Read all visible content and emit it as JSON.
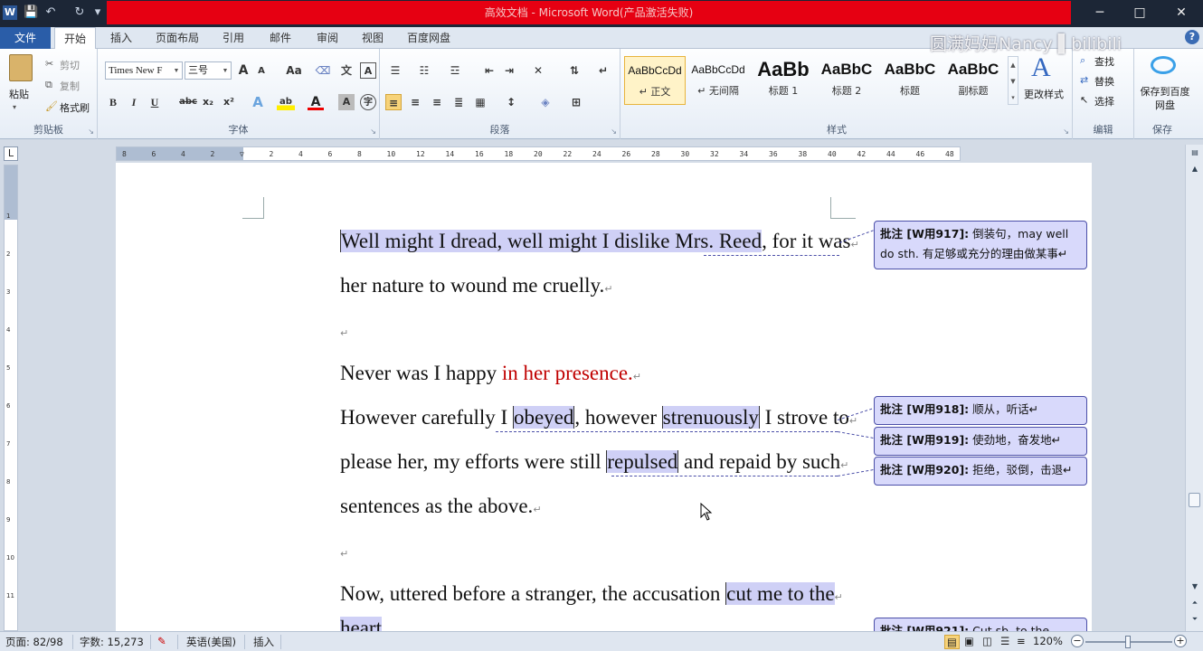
{
  "window": {
    "title": "高效文档 - Microsoft Word(产品激活失败)",
    "app_icon": "W",
    "watermark": "圆满妈妈Nancy ▌bilibili",
    "controls": {
      "minimize": "─",
      "maximize": "□",
      "close": "✕"
    }
  },
  "qat": {
    "save_icon": "💾",
    "undo_icon": "↶",
    "redo_icon": "↻",
    "more_icon": "▾"
  },
  "tabs": {
    "file": "文件",
    "items": [
      "开始",
      "插入",
      "页面布局",
      "引用",
      "邮件",
      "审阅",
      "视图",
      "百度网盘"
    ],
    "active": "开始",
    "help": "?"
  },
  "ribbon": {
    "clipboard": {
      "label": "剪贴板",
      "paste": "粘贴",
      "cut": "剪切",
      "copy": "复制",
      "format_painter": "格式刷"
    },
    "font": {
      "label": "字体",
      "font_name": "Times New F",
      "font_size": "三号",
      "grow": "A",
      "shrink": "A",
      "change_case": "Aa",
      "bold": "B",
      "italic": "I",
      "underline": "U",
      "strike": "abc",
      "subscript": "x₂",
      "superscript": "x²",
      "text_effect": "A",
      "highlight": "ab",
      "font_color": "A",
      "char_shading": "A",
      "enclose": "字"
    },
    "paragraph": {
      "label": "段落"
    },
    "styles": {
      "label": "样式",
      "items": [
        {
          "sample": "AaBbCcDd",
          "name": "↵ 正文"
        },
        {
          "sample": "AaBbCcDd",
          "name": "↵ 无间隔"
        },
        {
          "sample": "AaBb",
          "name": "标题 1"
        },
        {
          "sample": "AaBbC",
          "name": "标题 2"
        },
        {
          "sample": "AaBbC",
          "name": "标题"
        },
        {
          "sample": "AaBbC",
          "name": "副标题"
        }
      ],
      "change_styles": "更改样式"
    },
    "editing": {
      "label": "编辑",
      "find": "查找",
      "replace": "替换",
      "select": "选择"
    },
    "save": {
      "label": "保存",
      "save_to_baidu": "保存到百度网盘"
    }
  },
  "ruler": {
    "corner": "L",
    "ticks": [
      "8",
      "6",
      "4",
      "2",
      "",
      "2",
      "4",
      "6",
      "8",
      "10",
      "12",
      "14",
      "16",
      "18",
      "20",
      "22",
      "24",
      "26",
      "28",
      "30",
      "32",
      "34",
      "36",
      "38",
      "40",
      "42",
      "44",
      "46",
      "48"
    ]
  },
  "document": {
    "para_mark": "↵",
    "lines": {
      "l1_hl": "Well might I dread, well might I dislike Mrs. Reed",
      "l1_rest": ", for it was",
      "l2": "her nature to wound me cruelly.",
      "l4_a": "Never was I happy ",
      "l4_red": "in her presence.",
      "l5_a": "However carefully I ",
      "l5_hl1": "obeyed",
      "l5_b": ", however ",
      "l5_hl2": "strenuously",
      "l5_c": " I strove to",
      "l6_a": "please her, my efforts were still ",
      "l6_hl": "repulsed",
      "l6_b": " and repaid by such",
      "l7": "sentences as the above.",
      "l9_a": "Now, uttered before a stranger, the accusation ",
      "l9_hl": "cut me to the",
      "l10_hl": "heart"
    }
  },
  "comments": [
    {
      "tag": "批注 [W用917]:",
      "text": " 倒装句，may well do sth. 有足够或充分的理由做某事↵"
    },
    {
      "tag": "批注 [W用918]:",
      "text": " 顺从，听话↵"
    },
    {
      "tag": "批注 [W用919]:",
      "text": " 使劲地，奋发地↵"
    },
    {
      "tag": "批注 [W用920]:",
      "text": " 拒绝，驳倒，击退↵"
    },
    {
      "tag": "批注 [W用921]:",
      "text": " Cut sb. to the heart"
    }
  ],
  "status": {
    "page": "页面: 82/98",
    "words": "字数: 15,273",
    "language": "英语(美国)",
    "mode": "插入",
    "zoom": "120%",
    "zoom_minus": "−",
    "zoom_plus": "+"
  }
}
